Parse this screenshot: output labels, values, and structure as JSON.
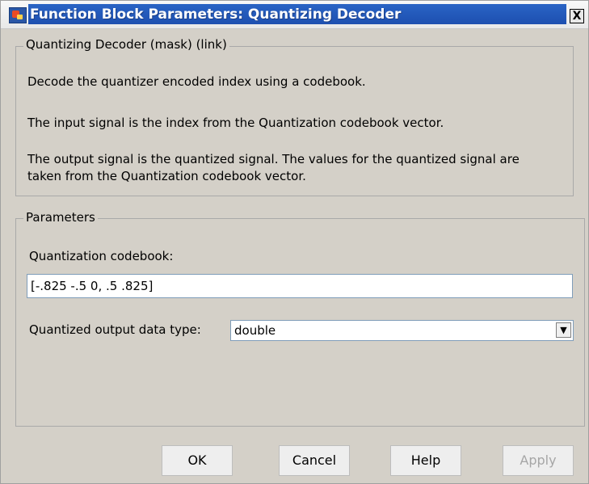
{
  "window": {
    "title": "Function Block Parameters: Quantizing Decoder",
    "close_glyph": "X"
  },
  "description_group": {
    "legend": "Quantizing Decoder (mask) (link)",
    "lines": [
      "Decode the quantizer encoded index using a codebook.",
      "The input signal is the index from the Quantization codebook vector.",
      "The output signal is the quantized signal.  The values for the quantized signal are",
      "taken from the Quantization codebook vector."
    ]
  },
  "parameters_group": {
    "legend": "Parameters",
    "codebook_label": "Quantization codebook:",
    "codebook_value": "[-.825 -.5 0, .5 .825]",
    "datatype_label": "Quantized output data type:",
    "datatype_value": "double"
  },
  "buttons": {
    "ok": "OK",
    "cancel": "Cancel",
    "help": "Help",
    "apply": "Apply"
  },
  "icons": {
    "dropdown_arrow": "▼",
    "app": "simulink-block-icon"
  }
}
